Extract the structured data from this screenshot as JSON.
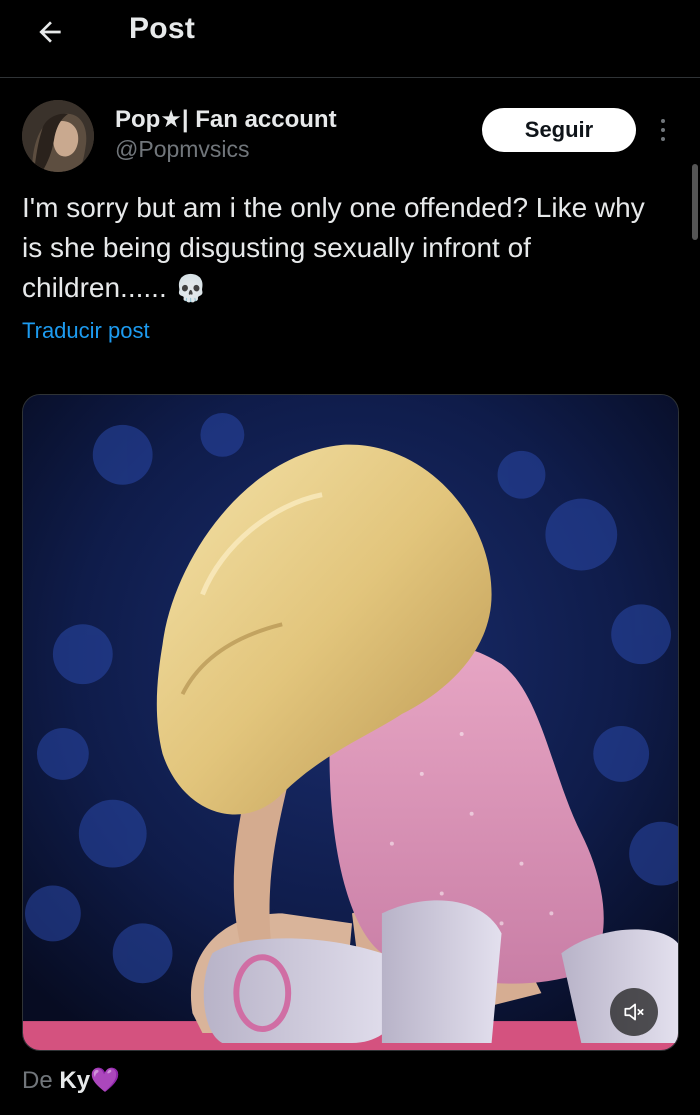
{
  "header": {
    "back_icon": "arrow-left-icon",
    "title": "Post"
  },
  "author": {
    "display_name": "Pop★| Fan account",
    "handle": "@Popmvsics",
    "follow_label": "Seguir",
    "more_icon": "more-vertical-icon"
  },
  "post": {
    "text": "I'm sorry but am i the only one offended? Like why is she being disgusting sexually infront of children......",
    "emoji": "💀",
    "translate_label": "Traducir post"
  },
  "media": {
    "mute_icon": "volume-muted-icon"
  },
  "credit": {
    "prefix": "De",
    "name": "Ky",
    "emoji": "💜"
  },
  "colors": {
    "background": "#000000",
    "text": "#e7e9ea",
    "secondary_text": "#71767b",
    "link": "#1d9bf0",
    "follow_button_bg": "#ffffff",
    "divider": "#2f3336"
  }
}
